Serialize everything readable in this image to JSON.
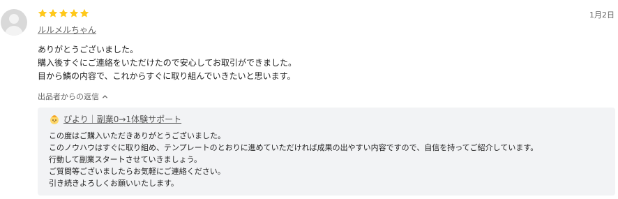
{
  "review": {
    "rating": 5,
    "rating_max": 5,
    "star_color": "#ffc81a",
    "date": "1月2日",
    "username": "ルルメルちゃん",
    "avatar_icon": "user-avatar-icon",
    "lines": [
      "ありがとうございました。",
      "購入後すぐにご連絡をいただけたので安心してお取引ができました。",
      "目から鱗の内容で、これからすぐに取り組んでいきたいと思います。"
    ]
  },
  "reply": {
    "toggle_label": "出品者からの返信",
    "toggle_icon": "chevron-up-icon",
    "seller_icon": "seller-avatar-icon",
    "seller_name": "ぴより｜副業0→1体験サポート",
    "box_color": "#f2f3f5",
    "lines": [
      "この度はご購入いただきありがとうございました。",
      "このノウハウはすぐに取り組め、テンプレートのとおりに進めていただければ成果の出やすい内容ですので、自信を持ってご紹介しています。",
      "行動して副業スタートさせていきましょう。",
      "ご質問等ございましたらお気軽にご連絡ください。",
      "引き続きよろしくお願いいたします。"
    ]
  }
}
